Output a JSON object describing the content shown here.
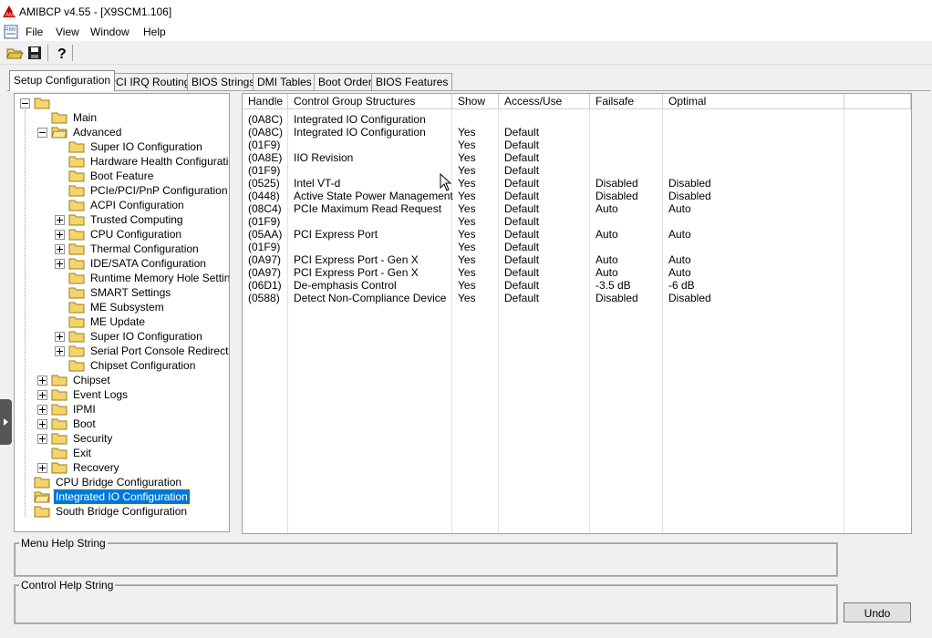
{
  "window": {
    "title": "AMIBCP v4.55 - [X9SCM1.106]"
  },
  "menu": {
    "icon_label": "RBM",
    "items": [
      "File",
      "View",
      "Window",
      "Help"
    ]
  },
  "toolbar": {
    "open_icon": "open-folder-icon",
    "save_icon": "save-icon",
    "help_icon": "help-icon"
  },
  "tabs": [
    "Setup Configuration",
    "PCI IRQ Routing",
    "BIOS Strings",
    "DMI Tables",
    "Boot Order",
    "BIOS Features"
  ],
  "active_tab": "Setup Configuration",
  "tree": {
    "root": "",
    "main": "Main",
    "advanced": "Advanced",
    "advanced_children": [
      "Super IO Configuration",
      "Hardware Health Configuration",
      "Boot Feature",
      "PCIe/PCI/PnP Configuration",
      "ACPI Configuration",
      "Trusted Computing",
      "CPU Configuration",
      "Thermal Configuration",
      "IDE/SATA Configuration",
      "Runtime Memory Hole Setting",
      "SMART Settings",
      "ME Subsystem",
      "ME Update",
      "Super IO Configuration",
      "Serial Port Console Redirection",
      "Chipset Configuration"
    ],
    "top_items": [
      "Chipset",
      "Event Logs",
      "IPMI",
      "Boot",
      "Security",
      "Exit",
      "Recovery"
    ],
    "bridges": [
      "CPU Bridge Configuration",
      "Integrated IO Configuration",
      "South Bridge Configuration"
    ],
    "selected": "Integrated IO Configuration"
  },
  "table": {
    "headers": [
      "Handle",
      "Control Group Structures",
      "Show",
      "Access/Use",
      "Failsafe",
      "Optimal"
    ],
    "rows": [
      [
        "(0A8C)",
        "Integrated IO Configuration",
        "",
        "",
        "",
        ""
      ],
      [
        "(0A8C)",
        "Integrated IO Configuration",
        "Yes",
        "Default",
        "",
        ""
      ],
      [
        "(01F9)",
        "",
        "Yes",
        "Default",
        "",
        ""
      ],
      [
        "(0A8E)",
        "IIO Revision",
        "Yes",
        "Default",
        "",
        ""
      ],
      [
        "(01F9)",
        "",
        "Yes",
        "Default",
        "",
        ""
      ],
      [
        "(0525)",
        "Intel VT-d",
        "Yes",
        "Default",
        "Disabled",
        "Disabled"
      ],
      [
        "(0448)",
        "Active State Power Management",
        "Yes",
        "Default",
        "Disabled",
        "Disabled"
      ],
      [
        "(08C4)",
        "PCIe Maximum Read Request",
        "Yes",
        "Default",
        "Auto",
        "Auto"
      ],
      [
        "(01F9)",
        "",
        "Yes",
        "Default",
        "",
        ""
      ],
      [
        "(05AA)",
        "PCI Express Port",
        "Yes",
        "Default",
        "Auto",
        "Auto"
      ],
      [
        "(01F9)",
        "",
        "Yes",
        "Default",
        "",
        ""
      ],
      [
        "(0A97)",
        "PCI Express Port - Gen X",
        "Yes",
        "Default",
        "Auto",
        "Auto"
      ],
      [
        "(0A97)",
        "PCI Express Port - Gen X",
        "Yes",
        "Default",
        "Auto",
        "Auto"
      ],
      [
        "(06D1)",
        "De-emphasis Control",
        "Yes",
        "Default",
        "-3.5 dB",
        "-6 dB"
      ],
      [
        "(0588)",
        "Detect Non-Compliance Device",
        "Yes",
        "Default",
        "Disabled",
        "Disabled"
      ]
    ]
  },
  "help": {
    "menu_help_label": "Menu Help String",
    "control_help_label": "Control Help String"
  },
  "buttons": {
    "undo": "Undo"
  },
  "colors": {
    "selection": "#0078d7",
    "folder": "#f5d46b"
  }
}
